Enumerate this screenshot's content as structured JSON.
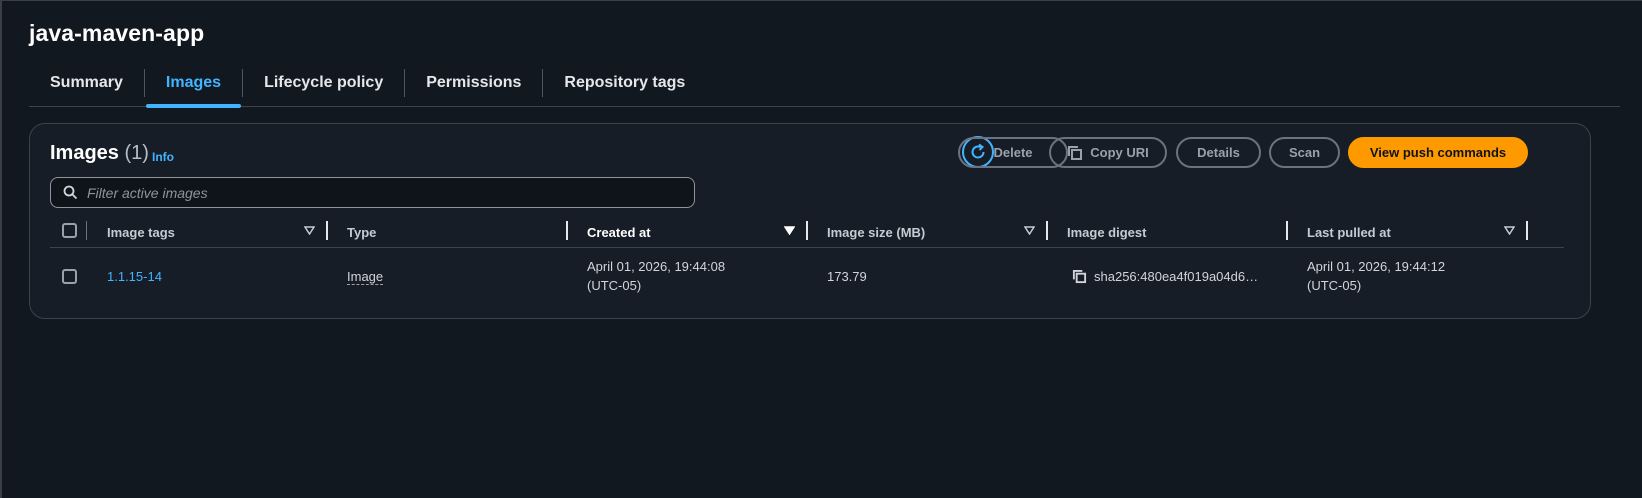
{
  "repo": {
    "title": "java-maven-app"
  },
  "tabs": [
    {
      "label": "Summary",
      "active": false
    },
    {
      "label": "Images",
      "active": true
    },
    {
      "label": "Lifecycle policy",
      "active": false
    },
    {
      "label": "Permissions",
      "active": false
    },
    {
      "label": "Repository tags",
      "active": false
    }
  ],
  "panel": {
    "title": "Images",
    "count": "(1)",
    "info": "Info",
    "buttons": {
      "delete": "Delete",
      "copy_uri": "Copy URI",
      "details": "Details",
      "scan": "Scan",
      "view_push": "View push commands"
    },
    "filter_placeholder": "Filter active images"
  },
  "table": {
    "columns": [
      "Image tags",
      "Type",
      "Created at",
      "Image size (MB)",
      "Image digest",
      "Last pulled at"
    ],
    "rows": [
      {
        "tag": "1.1.15-14",
        "type": "Image",
        "created_date": "April 01, 2026, 19:44:08",
        "created_tz": "(UTC-05)",
        "size": "173.79",
        "digest": "sha256:480ea4f019a04d6…",
        "pulled_date": "April 01, 2026, 19:44:12",
        "pulled_tz": "(UTC-05)"
      }
    ]
  },
  "colors": {
    "accent": "#42b4ff",
    "primary_button": "#ff9900"
  },
  "icons": [
    "refresh-icon",
    "copy-icon",
    "search-icon",
    "sort-icon"
  ]
}
